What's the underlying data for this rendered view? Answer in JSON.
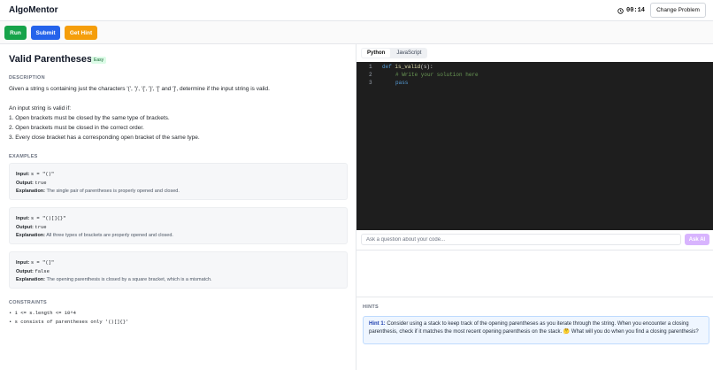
{
  "app": {
    "brand": "AlgoMentor",
    "timer": "00:14",
    "change_problem": "Change Problem"
  },
  "actions": {
    "run": "Run",
    "submit": "Submit",
    "hint": "Get Hint"
  },
  "problem": {
    "title": "Valid Parentheses",
    "difficulty": "Easy",
    "description_heading": "DESCRIPTION",
    "description": [
      "Given a string s containing just the characters '(', ')', '{', '}', '[' and ']', determine if the input string is valid.",
      "An input string is valid if:",
      "1. Open brackets must be closed by the same type of brackets.",
      "2. Open brackets must be closed in the correct order.",
      "3. Every close bracket has a corresponding open bracket of the same type."
    ],
    "examples_heading": "EXAMPLES",
    "examples": [
      {
        "input_label": "Input:",
        "input": "s = \"()\"",
        "output_label": "Output:",
        "output": "true",
        "explanation_label": "Explanation:",
        "explanation": "The single pair of parentheses is properly opened and closed."
      },
      {
        "input_label": "Input:",
        "input": "s = \"()[]{}\"",
        "output_label": "Output:",
        "output": "true",
        "explanation_label": "Explanation:",
        "explanation": "All three types of brackets are properly opened and closed."
      },
      {
        "input_label": "Input:",
        "input": "s = \"(]\"",
        "output_label": "Output:",
        "output": "false",
        "explanation_label": "Explanation:",
        "explanation": "The opening parenthesis is closed by a square bracket, which is a mismatch."
      }
    ],
    "constraints_heading": "CONSTRAINTS",
    "constraints": [
      "1 <= s.length <= 10^4",
      "s consists of parentheses only '()[]{}'"
    ]
  },
  "editor": {
    "tabs": [
      "Python",
      "JavaScript"
    ],
    "active_tab": "Python",
    "line_numbers": [
      "1",
      "2",
      "3"
    ],
    "code": {
      "kw_def": "def",
      "fn_name": "is_valid",
      "params": "(s):",
      "comment": "# Write your solution here",
      "pass": "pass"
    }
  },
  "assistant": {
    "placeholder": "Ask a question about your code...",
    "ask_label": "Ask AI"
  },
  "hints": {
    "heading": "HINTS",
    "items": [
      {
        "label": "Hint 1:",
        "text": "Consider using a stack to keep track of the opening parentheses as you iterate through the string. When you encounter a closing parenthesis, check if it matches the most recent opening parenthesis on the stack. 🤔 What will you do when you find a closing parenthesis?"
      }
    ]
  },
  "colors": {
    "run": "#16a34a",
    "submit": "#2563eb",
    "hint": "#f59e0b",
    "ask": "#d8b4fe",
    "editor_bg": "#1e1e1e"
  }
}
